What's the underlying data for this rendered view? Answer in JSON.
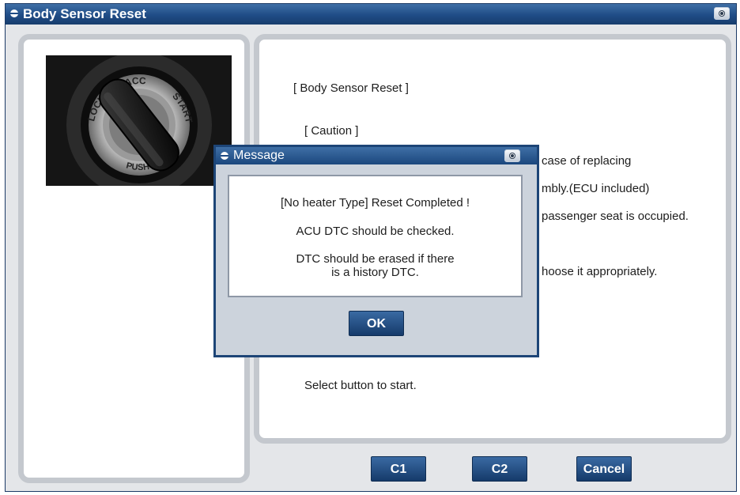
{
  "window": {
    "title": "Body Sensor Reset"
  },
  "content": {
    "heading": "[ Body Sensor Reset ]",
    "caution": "[ Caution ]",
    "line1": "case of replacing",
    "line2": "mbly.(ECU included)",
    "line3": "passenger seat is occupied.",
    "line4": "hoose it appropriately.",
    "prompt": "Select button to start."
  },
  "buttons": {
    "c1": "C1",
    "c2": "C2",
    "cancel": "Cancel"
  },
  "dialog": {
    "title": "Message",
    "line1": "[No heater Type] Reset Completed !",
    "line2": "ACU DTC should be checked.",
    "line3a": "DTC should be erased if there",
    "line3b": "is a history DTC.",
    "ok": "OK"
  },
  "image": {
    "icon": "ignition-switch-photo",
    "labels": {
      "lock": "LOCK",
      "acc": "ACC",
      "start": "START",
      "push": "PUSH"
    }
  },
  "colors": {
    "titlebar": "#1f4c86",
    "button": "#1f4c86",
    "panel_border": "#c4c8ce"
  }
}
